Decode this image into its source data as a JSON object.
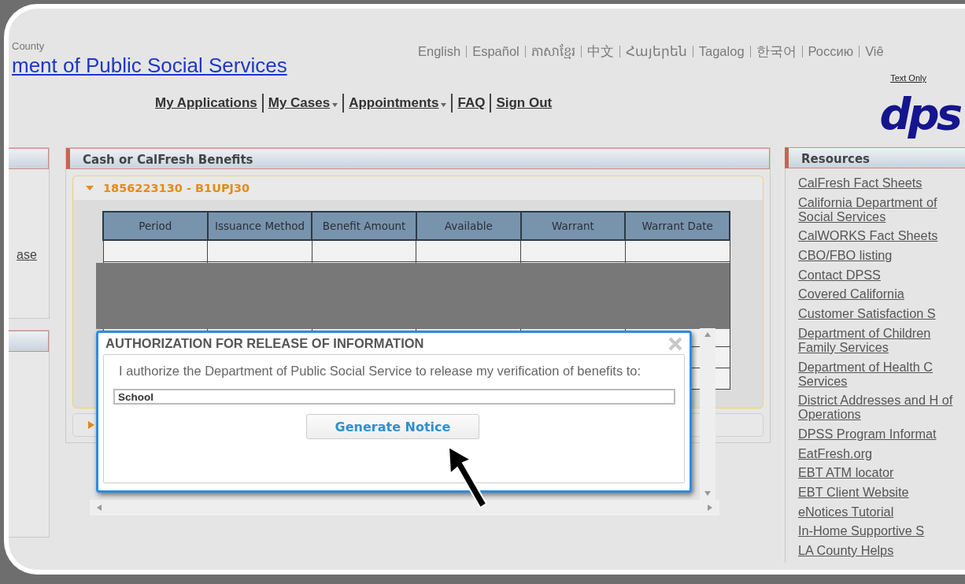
{
  "header": {
    "agency_prefix": "County",
    "agency_title": "ment of Public Social Services",
    "languages": [
      "English",
      "Español",
      "ភាសាខ្មែរ",
      "中文",
      "Հայերեն",
      "Tagalog",
      "한국어",
      "Россию",
      "Viê"
    ],
    "utility_links": [
      "Text Only"
    ],
    "logo": "dps"
  },
  "nav": [
    {
      "label": "My Applications",
      "dropdown": false
    },
    {
      "label": "My Cases",
      "dropdown": true
    },
    {
      "label": "Appointments",
      "dropdown": true
    },
    {
      "label": "FAQ",
      "dropdown": false
    },
    {
      "label": "Sign Out",
      "dropdown": false
    }
  ],
  "left_sidebar": {
    "links": [
      "ase"
    ]
  },
  "benefits_panel": {
    "title": "Cash or CalFresh Benefits",
    "cases": [
      {
        "label": "1856223130 - B1UPJ30",
        "expanded": true
      },
      {
        "expanded": false
      }
    ],
    "table": {
      "columns": [
        "Period",
        "Issuance Method",
        "Benefit Amount",
        "Available",
        "Warrant",
        "Warrant Date"
      ]
    }
  },
  "dialog": {
    "title": "AUTHORIZATION FOR RELEASE OF INFORMATION",
    "message": "I authorize the Department of Public Social Service to release my verification of benefits to:",
    "field_value": "School",
    "button": "Generate Notice"
  },
  "resources": {
    "title": "Resources",
    "links": [
      "CalFresh Fact Sheets",
      "California Department of Social Services",
      "CalWORKS Fact Sheets",
      "CBO/FBO listing",
      "Contact DPSS",
      "Covered California",
      "Customer Satisfaction S",
      "Department of Children Family Services",
      "Department of Health C Services",
      "District Addresses and H of Operations",
      "DPSS Program Informat",
      "EatFresh.org",
      "EBT ATM locator",
      "EBT Client Website",
      "eNotices Tutorial",
      "In-Home Supportive S",
      "LA County Helps"
    ]
  }
}
